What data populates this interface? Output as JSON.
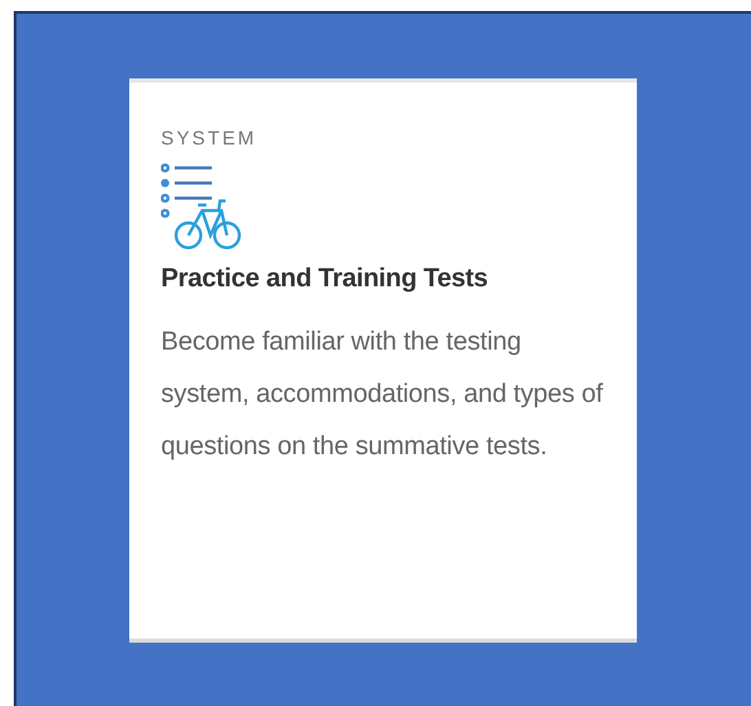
{
  "card": {
    "category": "SYSTEM",
    "title": "Practice and Training Tests",
    "description": "Become familiar with the testing system, accommodations, and types of questions on the summative tests."
  }
}
